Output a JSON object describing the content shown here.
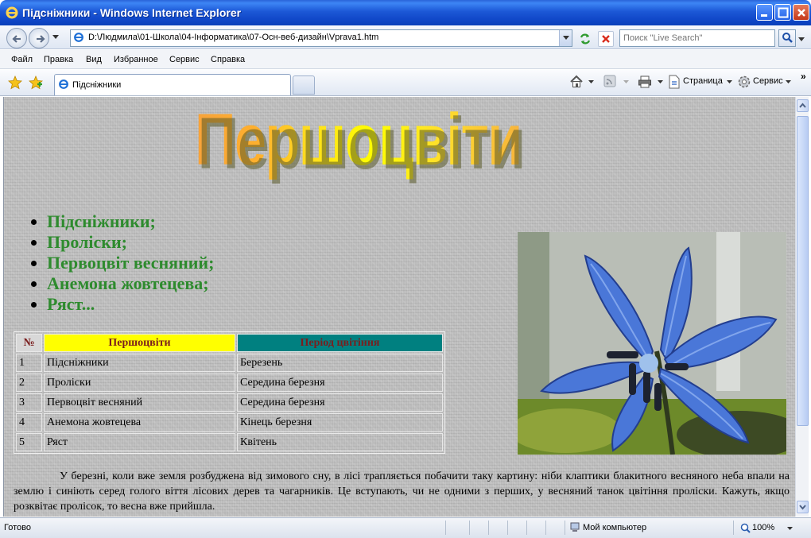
{
  "window": {
    "title": "Підсніжники - Windows Internet Explorer"
  },
  "address_bar": {
    "url": "D:\\Людмила\\01-Школа\\04-Інформатика\\07-Осн-веб-дизайн\\Vprava1.htm",
    "search_placeholder": "Поиск \"Live Search\""
  },
  "menu": {
    "items": [
      "Файл",
      "Правка",
      "Вид",
      "Избранное",
      "Сервис",
      "Справка"
    ]
  },
  "tab": {
    "label": "Підсніжники"
  },
  "command_bar": {
    "page_label": "Страница",
    "tools_label": "Сервис"
  },
  "page": {
    "headline": "Першоцвіти",
    "flowers": [
      "Підсніжники;",
      "Проліски;",
      "Первоцвіт весняний;",
      "Анемона жовтецева;",
      "Ряст..."
    ],
    "table": {
      "headers": [
        "№",
        "Першоцвіти",
        "Період цвітіння"
      ],
      "header_colors": {
        "number": "#d8d8d8",
        "flowers": "#ffff00",
        "period": "#008080"
      },
      "rows": [
        [
          "1",
          "Підсніжники",
          "Березень"
        ],
        [
          "2",
          "Проліски",
          "Середина березня"
        ],
        [
          "3",
          "Первоцвіт весняний",
          "Середина березня"
        ],
        [
          "4",
          "Анемона жовтецева",
          "Кінець березня"
        ],
        [
          "5",
          "Ряст",
          "Квітень"
        ]
      ]
    },
    "photo_subject": "scilla-blue-flower-photo",
    "paragraph": "У березні, коли вже земля розбуджена від зимового сну, в лісі трапляється побачити таку картину: ніби клаптики блакитного весняного неба впали на землю і синіють серед голого віття лісових дерев та чагарників. Це вступають, чи не одними з перших, у весняний танок цвітіння проліски. Кажуть, якщо розквітає пролісок, то весна вже прийшла."
  },
  "status_bar": {
    "status": "Готово",
    "zone": "Мой компьютер",
    "zoom": "100%"
  },
  "colors": {
    "list_text": "#2e8b2e",
    "table_header_text": "#7a1e1e",
    "title_bar": "#0f46c7"
  }
}
